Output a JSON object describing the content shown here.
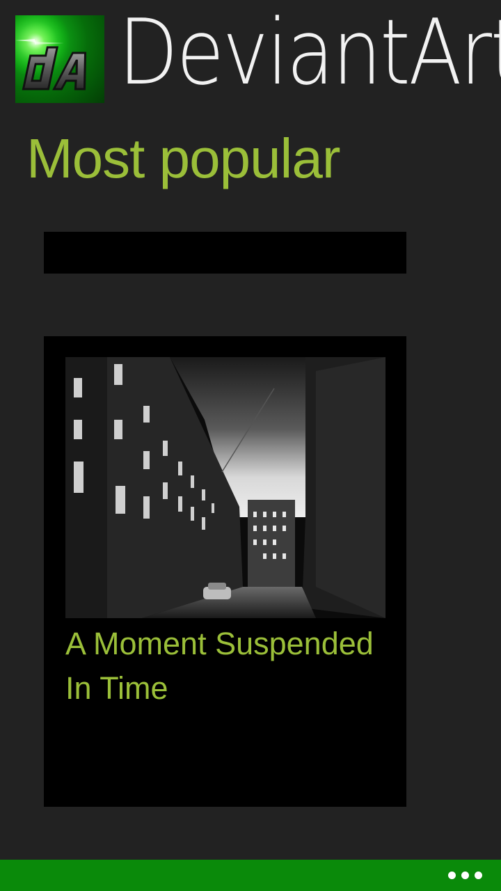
{
  "app": {
    "title": "DeviantArt",
    "logo_text": "dA"
  },
  "section": {
    "title": "Most popular"
  },
  "cards": [
    {
      "image": "dark-alley-photo",
      "title": "A Moment Suspended In Time"
    }
  ],
  "app_bar": {
    "more_icon": "ellipsis-icon"
  },
  "colors": {
    "background": "#222222",
    "accent": "#9bbf39",
    "app_bar": "#0a8a0a",
    "card": "#000000"
  }
}
